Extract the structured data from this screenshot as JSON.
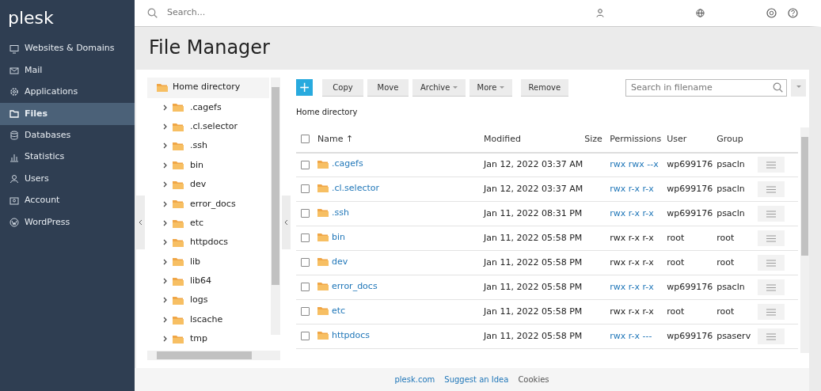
{
  "brand": "plesk",
  "sidebar": {
    "items": [
      {
        "label": "Websites & Domains",
        "selected": false
      },
      {
        "label": "Mail",
        "selected": false
      },
      {
        "label": "Applications",
        "selected": false
      },
      {
        "label": "Files",
        "selected": true
      },
      {
        "label": "Databases",
        "selected": false
      },
      {
        "label": "Statistics",
        "selected": false
      },
      {
        "label": "Users",
        "selected": false
      },
      {
        "label": "Account",
        "selected": false
      },
      {
        "label": "WordPress",
        "selected": false
      }
    ]
  },
  "search": {
    "placeholder": "Search..."
  },
  "page_title": "File Manager",
  "tree": {
    "root": "Home directory",
    "children": [
      {
        "label": ".cagefs",
        "expanded": false
      },
      {
        "label": ".cl.selector",
        "expanded": false
      },
      {
        "label": ".ssh",
        "expanded": false
      },
      {
        "label": "bin",
        "expanded": false
      },
      {
        "label": "dev",
        "expanded": false
      },
      {
        "label": "error_docs",
        "expanded": false
      },
      {
        "label": "etc",
        "expanded": false
      },
      {
        "label": "httpdocs",
        "expanded": false
      },
      {
        "label": "lib",
        "expanded": false
      },
      {
        "label": "lib64",
        "expanded": false
      },
      {
        "label": "logs",
        "expanded": false
      },
      {
        "label": "lscache",
        "expanded": false
      },
      {
        "label": "tmp",
        "expanded": false
      }
    ]
  },
  "toolbar": {
    "add": "+",
    "buttons": [
      {
        "label": "Copy",
        "dropdown": false
      },
      {
        "label": "Move",
        "dropdown": false
      },
      {
        "label": "Archive",
        "dropdown": true
      },
      {
        "label": "More",
        "dropdown": true
      },
      {
        "label": "Remove",
        "dropdown": false
      }
    ],
    "search_placeholder": "Search in filename"
  },
  "breadcrumb": "Home directory",
  "table": {
    "all_checked": false,
    "columns": [
      "Name ↑",
      "Modified",
      "Size",
      "Permissions",
      "User",
      "Group"
    ],
    "rows": [
      {
        "name": ".cagefs",
        "modified": "Jan 12, 2022 03:37 AM",
        "permissions": "rwx rwx --x",
        "editable": true,
        "user": "wp699176",
        "group": "psacln",
        "checked": false
      },
      {
        "name": ".cl.selector",
        "modified": "Jan 12, 2022 03:37 AM",
        "permissions": "rwx r-x r-x",
        "editable": true,
        "user": "wp699176",
        "group": "psacln",
        "checked": false
      },
      {
        "name": ".ssh",
        "modified": "Jan 11, 2022 08:31 PM",
        "permissions": "rwx r-x r-x",
        "editable": true,
        "user": "wp699176",
        "group": "psacln",
        "checked": false
      },
      {
        "name": "bin",
        "modified": "Jan 11, 2022 05:58 PM",
        "permissions": "rwx r-x r-x",
        "editable": false,
        "user": "root",
        "group": "root",
        "checked": false
      },
      {
        "name": "dev",
        "modified": "Jan 11, 2022 05:58 PM",
        "permissions": "rwx r-x r-x",
        "editable": false,
        "user": "root",
        "group": "root",
        "checked": false
      },
      {
        "name": "error_docs",
        "modified": "Jan 11, 2022 05:58 PM",
        "permissions": "rwx r-x r-x",
        "editable": true,
        "user": "wp699176",
        "group": "psacln",
        "checked": false
      },
      {
        "name": "etc",
        "modified": "Jan 11, 2022 05:58 PM",
        "permissions": "rwx r-x r-x",
        "editable": false,
        "user": "root",
        "group": "root",
        "checked": false
      },
      {
        "name": "httpdocs",
        "modified": "Jan 11, 2022 05:58 PM",
        "permissions": "rwx r-x ---",
        "editable": true,
        "user": "wp699176",
        "group": "psaserv",
        "checked": false
      }
    ]
  },
  "footer": [
    "plesk.com",
    "Suggest an Idea",
    "Cookies"
  ]
}
